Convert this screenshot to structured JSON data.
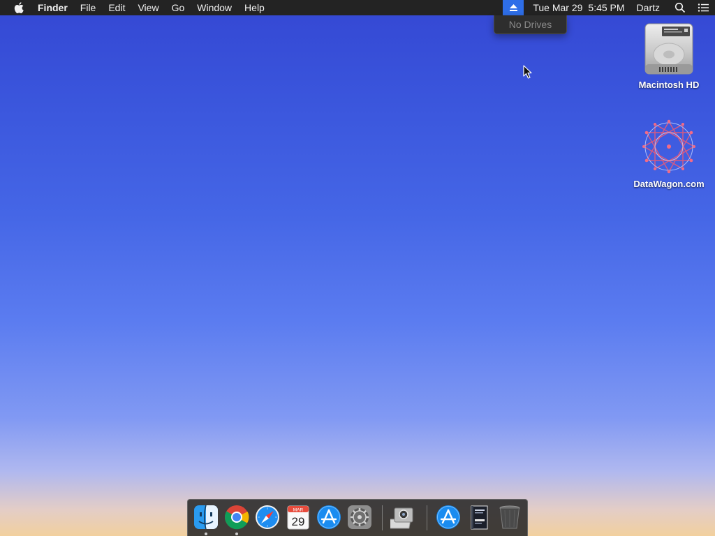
{
  "menubar": {
    "apple_icon": "apple-logo-icon",
    "app_name": "Finder",
    "menus": [
      "File",
      "Edit",
      "View",
      "Go",
      "Window",
      "Help"
    ],
    "status": {
      "eject_icon": "eject-icon",
      "date": "Tue Mar 29",
      "time": "5:45 PM",
      "user": "Dartz",
      "spotlight_icon": "search-icon",
      "notification_icon": "list-icon"
    },
    "colors": {
      "bar": "#232323",
      "active_extra": "#2e6ee8"
    }
  },
  "eject_menu": {
    "items": [
      "No Drives"
    ]
  },
  "desktop": {
    "icons": [
      {
        "label": "Macintosh HD",
        "icon": "hard-drive-icon"
      },
      {
        "label": "DataWagon.com",
        "icon": "datawagon-logo-icon"
      }
    ]
  },
  "dock": {
    "apps": [
      {
        "name": "finder",
        "icon": "finder-icon",
        "running": true
      },
      {
        "name": "chrome",
        "icon": "chrome-icon",
        "running": true
      },
      {
        "name": "safari",
        "icon": "safari-icon",
        "running": false
      },
      {
        "name": "calendar",
        "icon": "calendar-icon",
        "running": false,
        "month": "MAR",
        "day": "29"
      },
      {
        "name": "app-store",
        "icon": "app-store-icon",
        "running": false
      },
      {
        "name": "system-preferences",
        "icon": "gear-icon",
        "running": false
      },
      {
        "name": "image-capture",
        "icon": "camera-icon",
        "running": false
      },
      {
        "name": "app-store-downloads",
        "icon": "app-store-icon",
        "running": false
      },
      {
        "name": "ebook",
        "icon": "book-icon",
        "running": false
      },
      {
        "name": "trash",
        "icon": "trash-icon",
        "running": false
      }
    ]
  }
}
